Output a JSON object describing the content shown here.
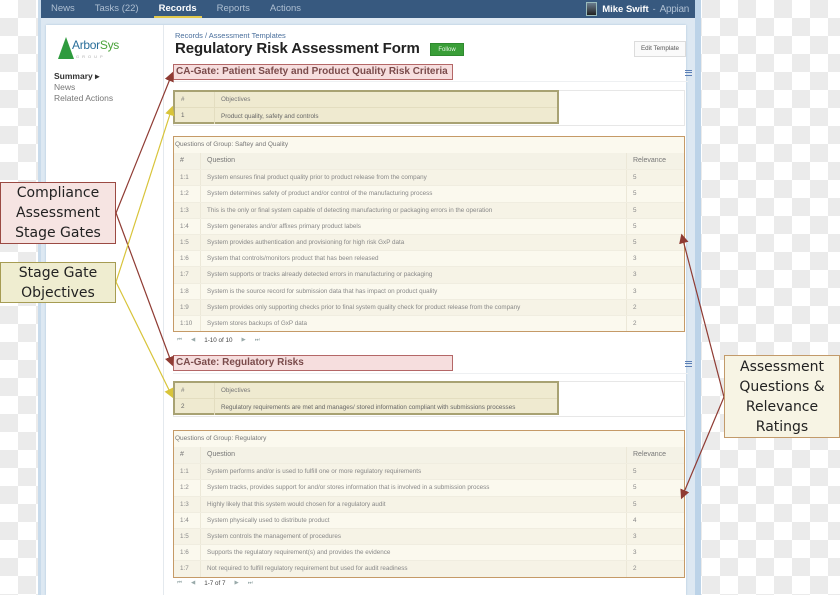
{
  "topnav": {
    "items": [
      {
        "label": "News",
        "active": false
      },
      {
        "label": "Tasks (22)",
        "active": false
      },
      {
        "label": "Records",
        "active": true
      },
      {
        "label": "Reports",
        "active": false
      },
      {
        "label": "Actions",
        "active": false
      }
    ],
    "user_name": "Mike Swift",
    "separator": "-",
    "brand": "Appian"
  },
  "sidebar": {
    "logo_text_a": "Arbor",
    "logo_text_b": "Sys",
    "logo_sub": "GROUP",
    "links": [
      {
        "label": "Summary ▸",
        "active": true
      },
      {
        "label": "News",
        "active": false
      },
      {
        "label": "Related Actions",
        "active": false
      }
    ]
  },
  "header": {
    "breadcrumb_root": "Records",
    "breadcrumb_sep": " / ",
    "breadcrumb_child": "Assessment Templates",
    "title": "Regulatory Risk Assessment Form",
    "follow_label": "Follow",
    "edit_label": "Edit Template"
  },
  "gates": [
    {
      "title": "CA-Gate: Patient Safety and Product Quality Risk Criteria",
      "objectives_header": {
        "num": "#",
        "text": "Objectives"
      },
      "objective": {
        "num": "1",
        "text": "Product quality, safety and controls"
      },
      "questions_caption": "Questions of Group:  Saftey and Quality",
      "questions_header": {
        "num": "#",
        "question": "Question",
        "relevance": "Relevance"
      },
      "questions": [
        {
          "num": "1:1",
          "question": "System ensures final product quality prior to product release from the company",
          "relevance": "5"
        },
        {
          "num": "1:2",
          "question": "System determines safety of product and/or control of the manufacturing process",
          "relevance": "5"
        },
        {
          "num": "1:3",
          "question": "This is the only or final system capable of detecting manufacturing or packaging errors in the operation",
          "relevance": "5"
        },
        {
          "num": "1:4",
          "question": "System generates and/or affixes primary product labels",
          "relevance": "5"
        },
        {
          "num": "1:5",
          "question": "System provides authentication and provisioning for high risk GxP data",
          "relevance": "5"
        },
        {
          "num": "1:6",
          "question": "System that controls/monitors product that has been released",
          "relevance": "3"
        },
        {
          "num": "1:7",
          "question": "System supports or tracks already detected errors in manufacturing or packaging",
          "relevance": "3"
        },
        {
          "num": "1:8",
          "question": "System is the source record for submission data that has impact on product quality",
          "relevance": "3"
        },
        {
          "num": "1:9",
          "question": "System provides only supporting checks prior to final system quality check for product release from the company",
          "relevance": "2"
        },
        {
          "num": "1:10",
          "question": "System stores backups of GxP data",
          "relevance": "2"
        }
      ],
      "pager_label": "1-10 of 10"
    },
    {
      "title": "CA-Gate: Regulatory Risks",
      "objectives_header": {
        "num": "#",
        "text": "Objectives"
      },
      "objective": {
        "num": "2",
        "text": "Regulatory requirements are met and manages/ stored information compliant with submissions processes"
      },
      "questions_caption": "Questions of Group:  Regulatory",
      "questions_header": {
        "num": "#",
        "question": "Question",
        "relevance": "Relevance"
      },
      "questions": [
        {
          "num": "1:1",
          "question": "System performs and/or is used to fulfill one or more regulatory requirements",
          "relevance": "5"
        },
        {
          "num": "1:2",
          "question": "System tracks, provides support for and/or stores information that is involved in a submission process",
          "relevance": "5"
        },
        {
          "num": "1:3",
          "question": "Highly likely that this system would chosen for a regulatory audit",
          "relevance": "5"
        },
        {
          "num": "1:4",
          "question": "System physically used to distribute product",
          "relevance": "4"
        },
        {
          "num": "1:5",
          "question": "System controls the management of procedures",
          "relevance": "3"
        },
        {
          "num": "1:6",
          "question": "Supports the regulatory requirement(s) and provides the evidence",
          "relevance": "3"
        },
        {
          "num": "1:7",
          "question": "Not required to fulfill regulatory requirement but used for audit readiness",
          "relevance": "2"
        }
      ],
      "pager_label": "1-7 of 7"
    }
  ],
  "pager_icons": {
    "first": "⏮",
    "prev": "◀",
    "next": "▶",
    "last": "⏭"
  },
  "callouts": {
    "stage_gates": [
      "Compliance",
      "Assessment",
      "Stage Gates"
    ],
    "objectives": [
      "Stage Gate",
      "Objectives"
    ],
    "questions": [
      "Assessment",
      "Questions &",
      "Relevance",
      "Ratings"
    ]
  },
  "colors": {
    "nav_bg": "#37597f",
    "follow_green": "#3a9e38",
    "gate_border": "#b46767",
    "objective_border": "#a8a273",
    "questions_border": "#c59a67",
    "arrow_red": "#8f3b33",
    "arrow_yellow": "#d8c43a"
  }
}
